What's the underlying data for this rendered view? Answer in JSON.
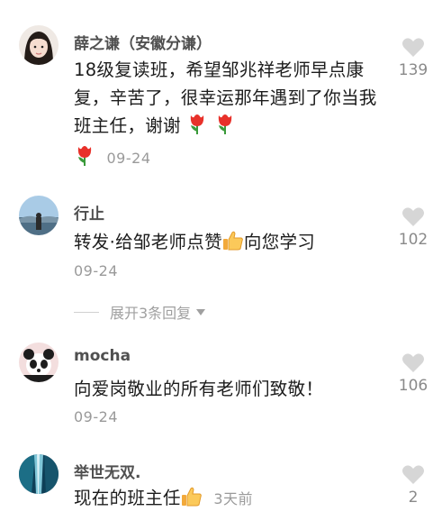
{
  "comments": [
    {
      "username": "薛之谦（安徽分谦）",
      "text": "18级复读班，希望邹兆祥老师早点康复，辛苦了，很幸运那年遇到了你当我班主任，谢谢",
      "date": "09-24",
      "likes": "139",
      "avatar_icon": "girl-avatar",
      "emoji_icon": "tulip-icon"
    },
    {
      "username": "行止",
      "text": "转发·给邹老师点赞",
      "text_after": "向您学习",
      "date": "09-24",
      "likes": "102",
      "avatar_icon": "landscape-avatar",
      "emoji_icon": "thumbs-up-icon"
    },
    {
      "username": "mocha",
      "text": "向爱岗敬业的所有老师们致敬！",
      "date": "09-24",
      "likes": "106",
      "avatar_icon": "panda-avatar"
    },
    {
      "username": "举世无双.",
      "text": "现在的班主任",
      "date": "3天前",
      "likes": "2",
      "avatar_icon": "waterfall-avatar",
      "emoji_icon": "thumbs-up-icon"
    }
  ],
  "expand_replies": "展开3条回复",
  "colors": {
    "username": "#505050",
    "meta": "#9a9a9a",
    "heart": "#d6d6d6",
    "tulip": "#e8312a"
  }
}
